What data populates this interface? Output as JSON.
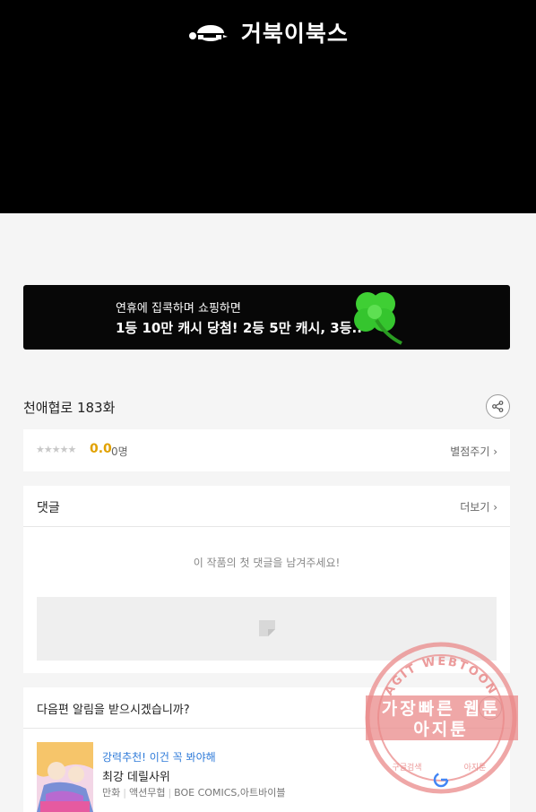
{
  "header": {
    "logo_text": "거북이북스",
    "logo_icon": "turtle-icon"
  },
  "banner": {
    "line1": "연휴에 집콕하며 쇼핑하면",
    "line2": "1등 10만 캐시 당첨! 2등 5만 캐시, 3등..",
    "icon": "four-leaf-clover-icon",
    "accent": "#35c52e"
  },
  "episode": {
    "title": "천애협로 183화",
    "share_icon": "share-icon"
  },
  "rating": {
    "stars": "★★★★★",
    "stars_filled": 0,
    "score": "0.0",
    "count": "0명",
    "rate_link": "별점주기 ›",
    "score_color": "#e1a100"
  },
  "comments": {
    "title": "댓글",
    "more": "더보기 ›",
    "empty_message": "이 작품의 첫 댓글을 남겨주세요!"
  },
  "next_episode": {
    "question": "다음편 알림을 받으시겠습니까?",
    "recommend_label": "강력추천! 이건 꼭 봐야해",
    "recommend_title": "최강 데릴사위",
    "genre1": "만화",
    "genre2": "액션무협",
    "publisher": "BOE COMICS,아트바이블",
    "label_color": "#2f7bd9"
  },
  "watermark": {
    "arc_text": "AGIT WEBTOON",
    "line1": "가장빠른 웹툰",
    "line2": "아지툰",
    "bottom_left": "구글검색",
    "bottom_right": "아지툰",
    "color": "#e98a8a"
  }
}
